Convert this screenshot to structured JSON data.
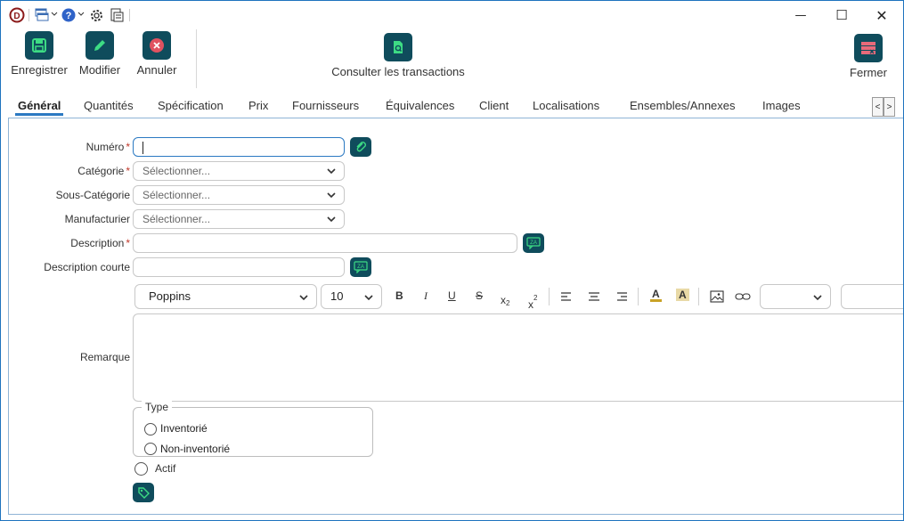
{
  "window": {
    "minimize": "—",
    "maximize": "☐",
    "close": "✕"
  },
  "ribbon": {
    "save_label": "Enregistrer",
    "edit_label": "Modifier",
    "cancel_label": "Annuler",
    "transactions_label": "Consulter les transactions",
    "close_label": "Fermer"
  },
  "tabs": [
    "Général",
    "Quantités",
    "Spécification",
    "Prix",
    "Fournisseurs",
    "Équivalences",
    "Client",
    "Localisations",
    "Ensembles/Annexes",
    "Images"
  ],
  "tab_arrows": {
    "left": "<",
    "right": ">"
  },
  "form": {
    "numero_label": "Numéro",
    "categorie_label": "Catégorie",
    "categorie_placeholder": "Sélectionner...",
    "souscategorie_label": "Sous-Catégorie",
    "souscategorie_placeholder": "Sélectionner...",
    "manufacturier_label": "Manufacturier",
    "manufacturier_placeholder": "Sélectionner...",
    "description_label": "Description",
    "description_courte_label": "Description courte",
    "remarque_label": "Remarque",
    "required_mark": "*"
  },
  "editor": {
    "font": "Poppins",
    "size": "10",
    "bold": "B",
    "italic": "I",
    "underline": "U",
    "strike": "S",
    "subscript": "x",
    "subscript_digit": "2",
    "superscript": "x",
    "superscript_digit": "2",
    "text_color": "A",
    "highlight": "A"
  },
  "type_group": {
    "legend": "Type",
    "option1": "Inventorié",
    "option2": "Non-inventorié"
  },
  "actif_label": "Actif",
  "colors": {
    "accent_button": "#0f4c5c",
    "tab_underline": "#2b79c2",
    "required": "#c0392b",
    "save_icon": "#3ddc84",
    "cancel_icon": "#e05260",
    "close_icon": "#e86a7a"
  }
}
